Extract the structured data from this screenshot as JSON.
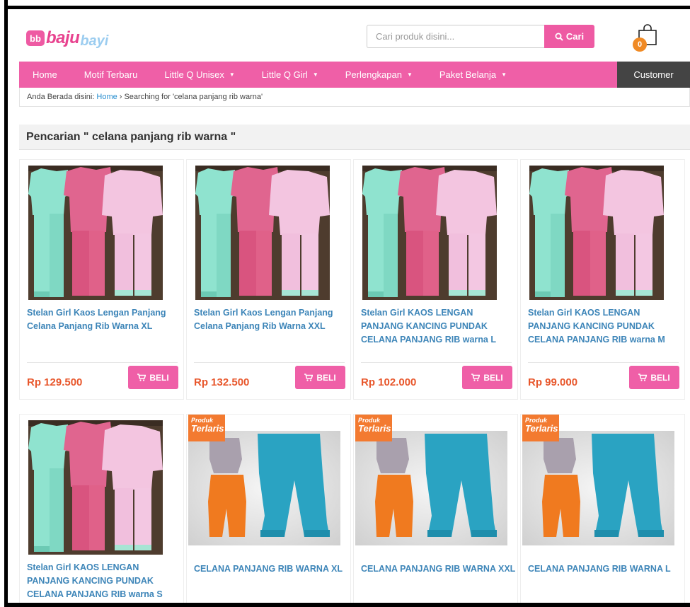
{
  "header": {
    "logo_text1": "baju",
    "logo_text2": "bayi",
    "logo_badge": "bb",
    "search_placeholder": "Cari produk disini...",
    "search_button": "Cari",
    "cart_count": "0"
  },
  "nav": {
    "items": [
      {
        "label": "Home",
        "dropdown": false
      },
      {
        "label": "Motif Terbaru",
        "dropdown": false
      },
      {
        "label": "Little Q Unisex",
        "dropdown": true
      },
      {
        "label": "Little Q Girl",
        "dropdown": true
      },
      {
        "label": "Perlengkapan",
        "dropdown": true
      },
      {
        "label": "Paket Belanja",
        "dropdown": true
      }
    ],
    "customer": "Customer"
  },
  "breadcrumb": {
    "prefix": "Anda Berada disini:",
    "home": "Home",
    "current": "› Searching for 'celana panjang rib warna'"
  },
  "results": {
    "heading": "Pencarian \" celana panjang rib warna \""
  },
  "buy_label": "BELI",
  "badge": {
    "line1": "Produk",
    "line2": "Terlaris"
  },
  "products": [
    {
      "name": "Stelan Girl Kaos Lengan Panjang Celana Panjang Rib Warna XL",
      "price": "Rp 129.500",
      "image": "pajama-set"
    },
    {
      "name": "Stelan Girl Kaos Lengan Panjang Celana Panjang Rib Warna XXL",
      "price": "Rp 132.500",
      "image": "pajama-set"
    },
    {
      "name": "Stelan Girl KAOS LENGAN PANJANG KANCING PUNDAK CELANA PANJANG RIB warna L",
      "price": "Rp 102.000",
      "image": "pajama-set"
    },
    {
      "name": "Stelan Girl KAOS LENGAN PANJANG KANCING PUNDAK CELANA PANJANG RIB warna M",
      "price": "Rp 99.000",
      "image": "pajama-set"
    },
    {
      "name": "Stelan Girl KAOS LENGAN PANJANG KANCING PUNDAK CELANA PANJANG RIB warna S",
      "price": "",
      "image": "pajama-set"
    },
    {
      "name": "CELANA PANJANG RIB WARNA XL",
      "price": "",
      "image": "pants-terlaris"
    },
    {
      "name": "CELANA PANJANG RIB WARNA XXL",
      "price": "",
      "image": "pants-terlaris"
    },
    {
      "name": "CELANA PANJANG RIB WARNA L",
      "price": "",
      "image": "pants-terlaris"
    }
  ],
  "colors": {
    "brand_pink": "#ef5fa7",
    "price_orange": "#e8572c",
    "link_blue": "#3d85b8",
    "customer_dark": "#444444"
  }
}
